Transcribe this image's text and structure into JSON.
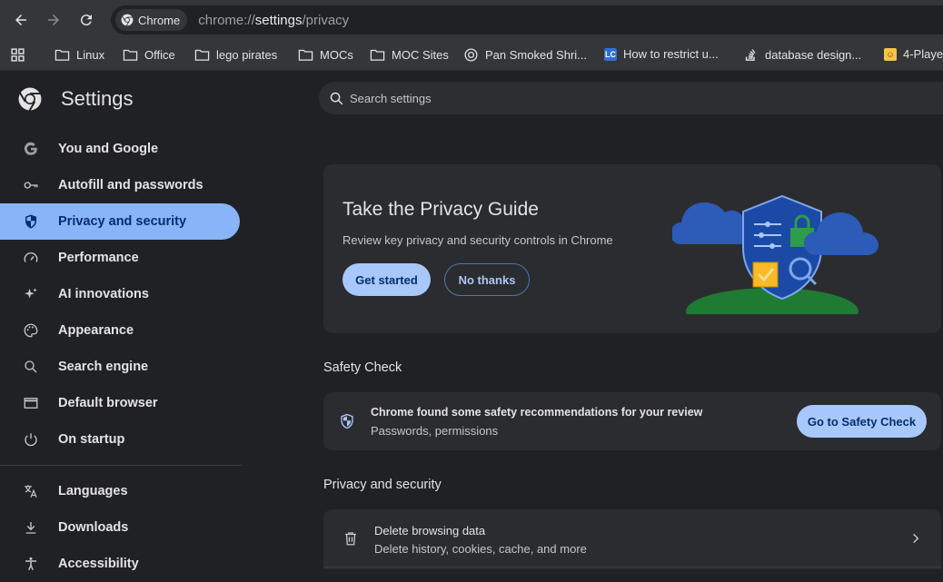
{
  "toolbar": {
    "chip_label": "Chrome",
    "url_prefix": "chrome://",
    "url_path": "settings",
    "url_suffix": "/privacy"
  },
  "bookmarks": [
    {
      "label": "Linux",
      "icon": "folder-icon"
    },
    {
      "label": "Office",
      "icon": "folder-icon"
    },
    {
      "label": "lego pirates",
      "icon": "folder-icon"
    },
    {
      "label": "MOCs",
      "icon": "folder-icon"
    },
    {
      "label": "MOC Sites",
      "icon": "folder-icon"
    },
    {
      "label": "Pan Smoked Shri...",
      "icon": "site-icon"
    },
    {
      "label": "How to restrict u...",
      "icon": "lc-badge-icon"
    },
    {
      "label": "database design...",
      "icon": "stackoverflow-icon"
    },
    {
      "label": "4-Playe",
      "icon": "game-icon"
    }
  ],
  "header": {
    "title": "Settings",
    "search_placeholder": "Search settings"
  },
  "sidebar": {
    "items": [
      {
        "label": "You and Google",
        "icon": "google-g-icon",
        "active": false
      },
      {
        "label": "Autofill and passwords",
        "icon": "key-icon",
        "active": false
      },
      {
        "label": "Privacy and security",
        "icon": "shield-icon",
        "active": true
      },
      {
        "label": "Performance",
        "icon": "speedometer-icon",
        "active": false
      },
      {
        "label": "AI innovations",
        "icon": "sparkle-icon",
        "active": false
      },
      {
        "label": "Appearance",
        "icon": "palette-icon",
        "active": false
      },
      {
        "label": "Search engine",
        "icon": "search-icon",
        "active": false
      },
      {
        "label": "Default browser",
        "icon": "browser-window-icon",
        "active": false
      },
      {
        "label": "On startup",
        "icon": "power-icon",
        "active": false
      },
      {
        "label": "Languages",
        "icon": "translate-icon",
        "active": false
      },
      {
        "label": "Downloads",
        "icon": "download-icon",
        "active": false
      },
      {
        "label": "Accessibility",
        "icon": "accessibility-icon",
        "active": false
      }
    ]
  },
  "privacy_guide": {
    "title": "Take the Privacy Guide",
    "subtitle": "Review key privacy and security controls in Chrome",
    "primary_button": "Get started",
    "secondary_button": "No thanks"
  },
  "safety_check": {
    "section_title": "Safety Check",
    "message": "Chrome found some safety recommendations for your review",
    "details": "Passwords, permissions",
    "button": "Go to Safety Check"
  },
  "privacy_section": {
    "section_title": "Privacy and security",
    "rows": [
      {
        "title": "Delete browsing data",
        "subtitle": "Delete history, cookies, cache, and more",
        "icon": "trash-icon"
      }
    ]
  },
  "colors": {
    "accent": "#a8c7fa",
    "active_nav": "#8ab4f8",
    "background": "#202124",
    "card": "#2b2c2f"
  }
}
